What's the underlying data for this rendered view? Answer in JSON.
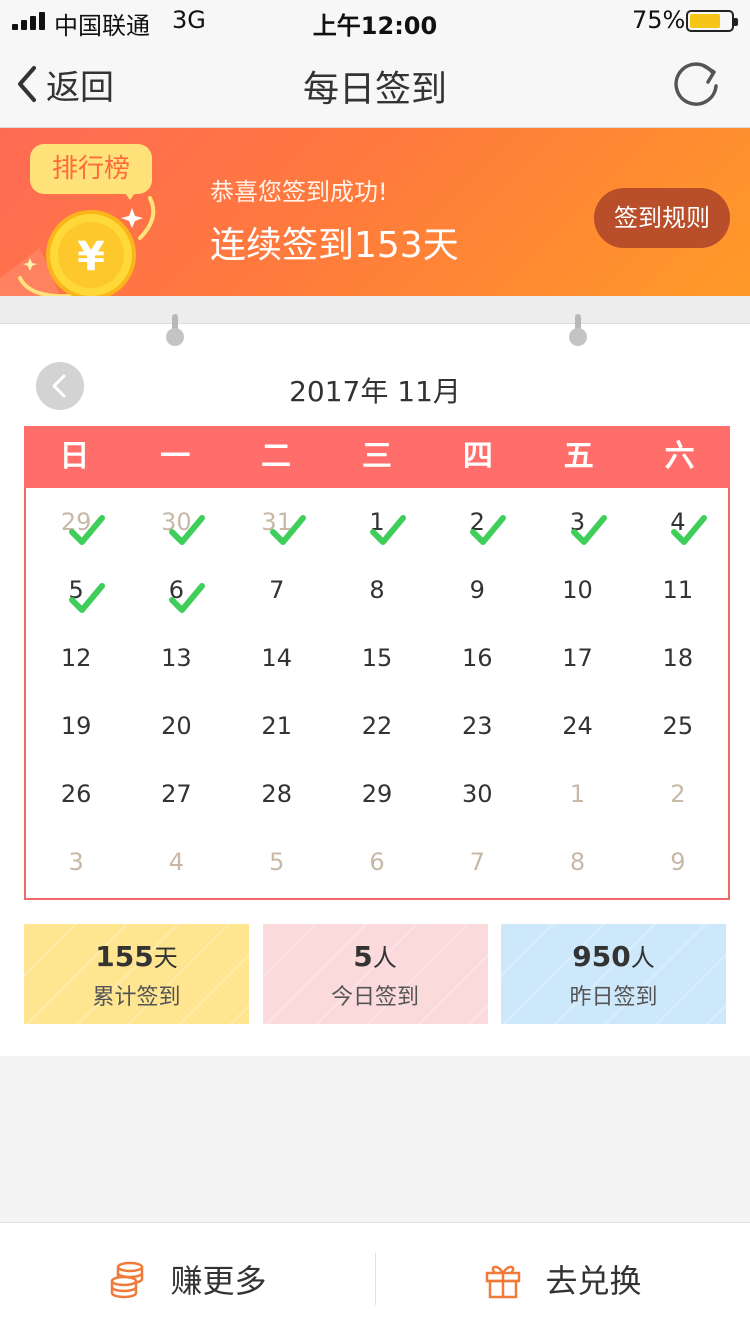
{
  "status_bar": {
    "carrier": "中国联通",
    "network": "3G",
    "time": "上午12:00",
    "battery": "75%",
    "battery_level": 0.75
  },
  "nav": {
    "back_label": "返回",
    "title": "每日签到",
    "refresh_icon": "refresh-icon"
  },
  "banner": {
    "rank_label": "排行榜",
    "subtitle": "恭喜您签到成功!",
    "streak_text": "连续签到153天",
    "rules_button": "签到规则",
    "colors": {
      "start": "#ff6a55",
      "end": "#ff9a28",
      "rules_bg": "#b84e2a",
      "badge": "#ffe27a"
    }
  },
  "calendar": {
    "month_label": "2017年 11月",
    "weekdays": [
      "日",
      "一",
      "二",
      "三",
      "四",
      "五",
      "六"
    ],
    "weeks": [
      [
        {
          "d": "29",
          "other": true,
          "checked": true
        },
        {
          "d": "30",
          "other": true,
          "checked": true
        },
        {
          "d": "31",
          "other": true,
          "checked": true
        },
        {
          "d": "1",
          "checked": true
        },
        {
          "d": "2",
          "checked": true
        },
        {
          "d": "3",
          "checked": true
        },
        {
          "d": "4",
          "checked": true
        }
      ],
      [
        {
          "d": "5",
          "checked": true
        },
        {
          "d": "6",
          "checked": true
        },
        {
          "d": "7"
        },
        {
          "d": "8"
        },
        {
          "d": "9"
        },
        {
          "d": "10"
        },
        {
          "d": "11"
        }
      ],
      [
        {
          "d": "12"
        },
        {
          "d": "13"
        },
        {
          "d": "14"
        },
        {
          "d": "15"
        },
        {
          "d": "16"
        },
        {
          "d": "17"
        },
        {
          "d": "18"
        }
      ],
      [
        {
          "d": "19"
        },
        {
          "d": "20"
        },
        {
          "d": "21"
        },
        {
          "d": "22"
        },
        {
          "d": "23"
        },
        {
          "d": "24"
        },
        {
          "d": "25"
        }
      ],
      [
        {
          "d": "26"
        },
        {
          "d": "27"
        },
        {
          "d": "28"
        },
        {
          "d": "29"
        },
        {
          "d": "30"
        },
        {
          "d": "1",
          "other": true
        },
        {
          "d": "2",
          "other": true
        }
      ],
      [
        {
          "d": "3",
          "other": true
        },
        {
          "d": "4",
          "other": true
        },
        {
          "d": "5",
          "other": true
        },
        {
          "d": "6",
          "other": true
        },
        {
          "d": "7",
          "other": true
        },
        {
          "d": "8",
          "other": true
        },
        {
          "d": "9",
          "other": true
        }
      ]
    ],
    "colors": {
      "header": "#ff6e6a",
      "check": "#3fce59",
      "other_day": "#c8b8a8"
    }
  },
  "stats": [
    {
      "value": "155",
      "unit": "天",
      "label": "累计签到"
    },
    {
      "value": "5",
      "unit": "人",
      "label": "今日签到"
    },
    {
      "value": "950",
      "unit": "人",
      "label": "昨日签到"
    }
  ],
  "bottom": {
    "earn_label": "赚更多",
    "exchange_label": "去兑换"
  }
}
